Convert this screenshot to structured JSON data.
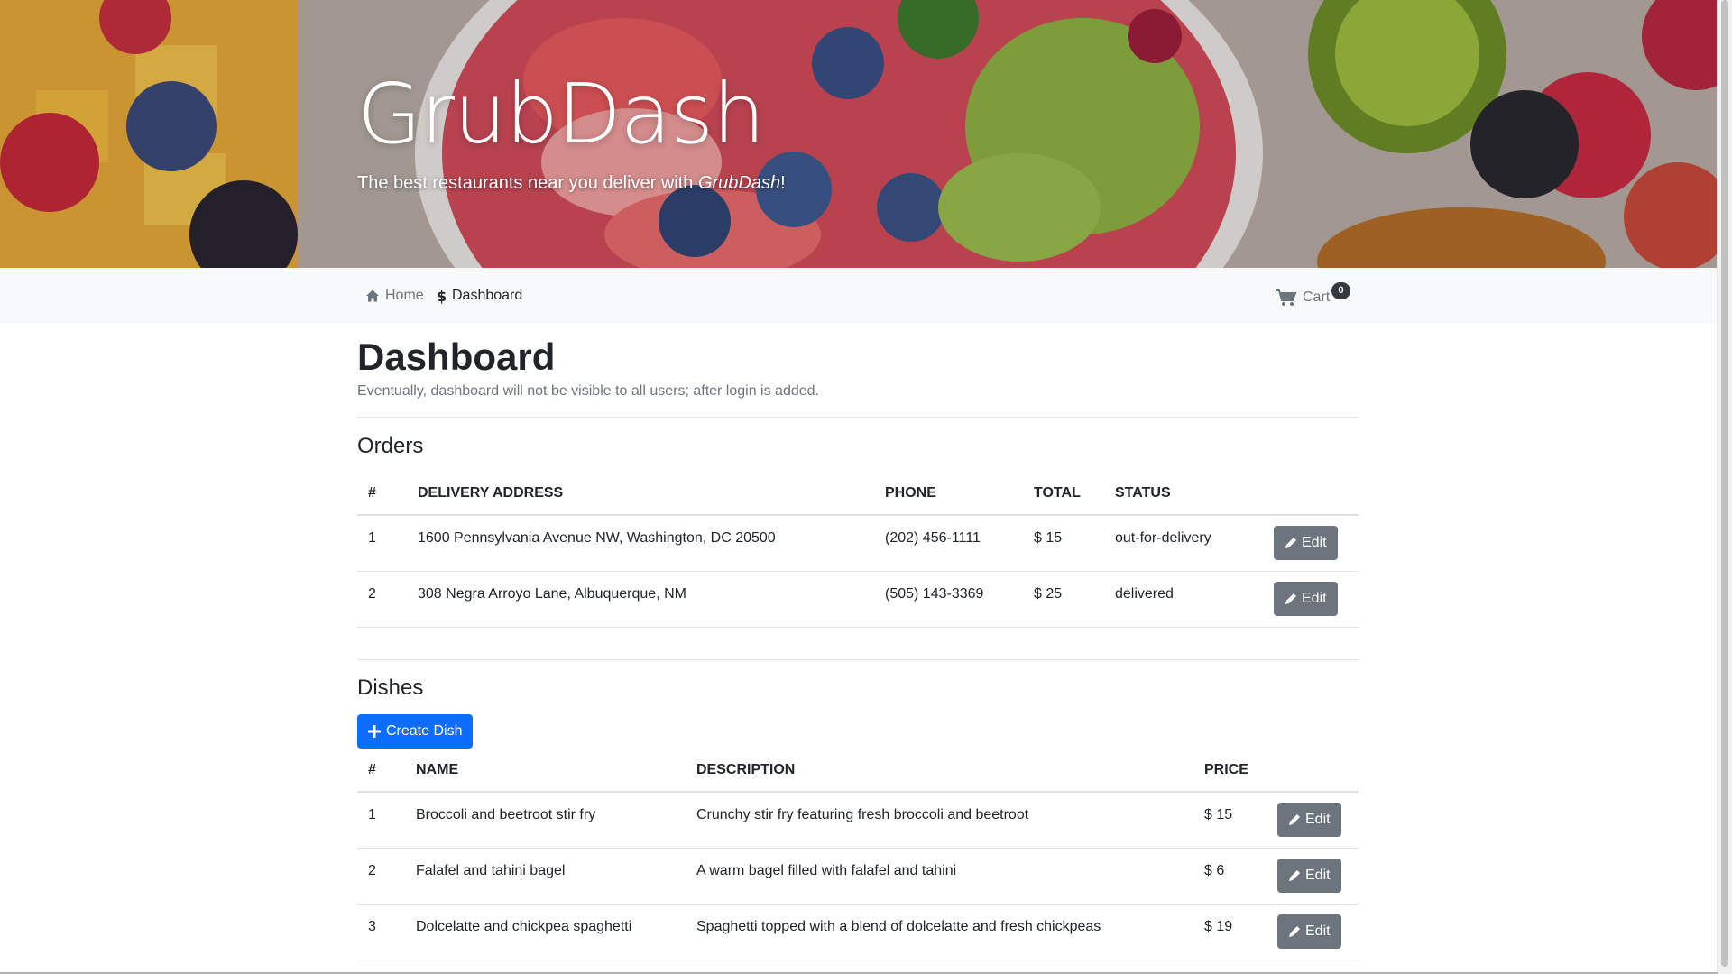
{
  "hero": {
    "title": "GrubDash",
    "tagline_prefix": "The best restaurants near you deliver with ",
    "tagline_brand": "GrubDash",
    "tagline_suffix": "!"
  },
  "nav": {
    "home": "Home",
    "dashboard": "Dashboard",
    "cart": "Cart",
    "cart_count": "0"
  },
  "page": {
    "title": "Dashboard",
    "lead": "Eventually, dashboard will not be visible to all users; after login is added."
  },
  "orders": {
    "title": "Orders",
    "columns": [
      "#",
      "Delivery Address",
      "Phone",
      "Total",
      "Status"
    ],
    "rows": [
      {
        "num": "1",
        "address": "1600 Pennsylvania Avenue NW, Washington, DC 20500",
        "phone": "(202) 456-1111",
        "total": "$ 15",
        "status": "out-for-delivery",
        "edit": "Edit"
      },
      {
        "num": "2",
        "address": "308 Negra Arroyo Lane, Albuquerque, NM",
        "phone": "(505) 143-3369",
        "total": "$ 25",
        "status": "delivered",
        "edit": "Edit"
      }
    ]
  },
  "dishes": {
    "title": "Dishes",
    "create_label": "Create Dish",
    "columns": [
      "#",
      "Name",
      "Description",
      "Price"
    ],
    "rows": [
      {
        "num": "1",
        "name": "Broccoli and beetroot stir fry",
        "description": "Crunchy stir fry featuring fresh broccoli and beetroot",
        "price": "$ 15",
        "edit": "Edit"
      },
      {
        "num": "2",
        "name": "Falafel and tahini bagel",
        "description": "A warm bagel filled with falafel and tahini",
        "price": "$ 6",
        "edit": "Edit"
      },
      {
        "num": "3",
        "name": "Dolcelatte and chickpea spaghetti",
        "description": "Spaghetti topped with a blend of dolcelatte and fresh chickpeas",
        "price": "$ 19",
        "edit": "Edit"
      }
    ]
  },
  "icons": {
    "home": "home-icon",
    "dollar": "dollar-icon",
    "cart": "cart-icon",
    "edit": "pencil-icon",
    "plus": "plus-icon"
  },
  "colors": {
    "primary": "#0d6efd",
    "secondary": "#6c757d",
    "navbar_bg": "#f8f9fa",
    "badge": "#343a40"
  }
}
